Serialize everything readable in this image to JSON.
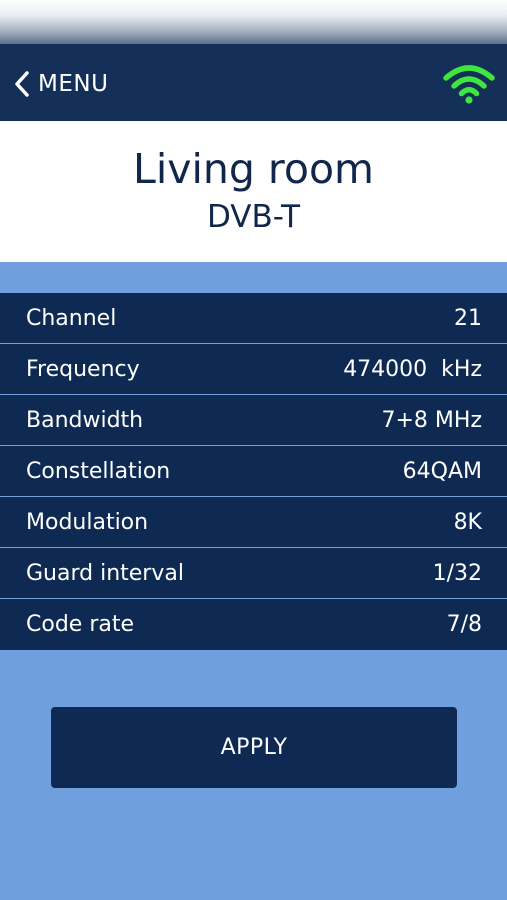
{
  "nav": {
    "back_label": "MENU",
    "wifi_color": "#3ee63e",
    "background": "#143058"
  },
  "header": {
    "title": "Living room",
    "subtitle": "DVB-T"
  },
  "parameters": [
    {
      "label": "Channel",
      "value": "21"
    },
    {
      "label": "Frequency",
      "value": "474000  kHz"
    },
    {
      "label": "Bandwidth",
      "value": "7+8 MHz"
    },
    {
      "label": "Constellation",
      "value": "64QAM"
    },
    {
      "label": "Modulation",
      "value": "8K"
    },
    {
      "label": "Guard interval",
      "value": "1/32"
    },
    {
      "label": "Code rate",
      "value": "7/8"
    }
  ],
  "apply_label": "APPLY",
  "colors": {
    "page_background": "#6f9fdd",
    "panel_dark": "#0e2a52",
    "text_dark": "#10264a"
  }
}
